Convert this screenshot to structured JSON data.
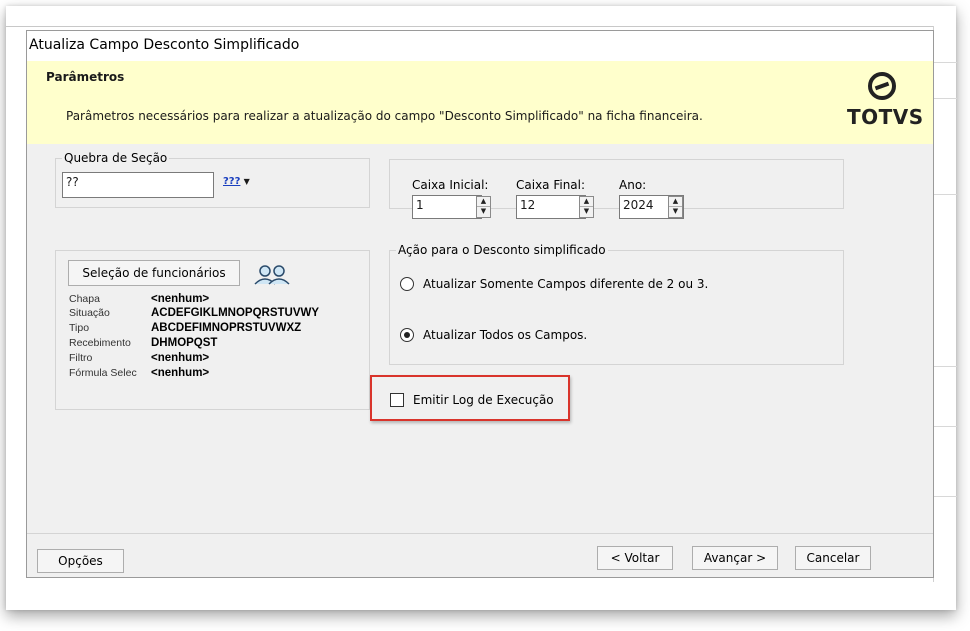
{
  "window": {
    "title": "Atualiza Campo Desconto Simplificado"
  },
  "header": {
    "title": "Parâmetros",
    "description": "Parâmetros necessários para realizar a atualização do campo \"Desconto Simplificado\" na ficha financeira.",
    "logo_text": "TOTVS"
  },
  "quebra": {
    "legend": "Quebra de Seção",
    "value": "??",
    "lookup_label": "???"
  },
  "caixa": {
    "inicial_label": "Caixa Inicial:",
    "inicial_value": "1",
    "final_label": "Caixa Final:",
    "final_value": "12",
    "ano_label": "Ano:",
    "ano_value": "2024"
  },
  "selecao": {
    "button_label": "Seleção de funcionários",
    "rows": [
      {
        "key": "Chapa",
        "value": "<nenhum>"
      },
      {
        "key": "Situação",
        "value": "ACDEFGIKLMNOPQRSTUVWY"
      },
      {
        "key": "Tipo",
        "value": "ABCDEFIMNOPRSTUVWXZ"
      },
      {
        "key": "Recebimento",
        "value": "DHMOPQST"
      },
      {
        "key": "Filtro",
        "value": "<nenhum>"
      },
      {
        "key": "Fórmula Selec",
        "value": "<nenhum>"
      }
    ]
  },
  "acao": {
    "legend": "Ação para o Desconto simplificado",
    "option1": "Atualizar Somente Campos diferente de 2 ou 3.",
    "option2": "Atualizar Todos os Campos.",
    "selected": "option2"
  },
  "log": {
    "label": "Emitir Log de Execução",
    "checked": false
  },
  "footer": {
    "opcoes": "Opções",
    "voltar": "< Voltar",
    "avancar": "Avançar >",
    "cancelar": "Cancelar"
  },
  "colors": {
    "header_bg": "#ffffcc",
    "highlight": "#d9342b",
    "dialog_bg": "#f0f0f0"
  }
}
